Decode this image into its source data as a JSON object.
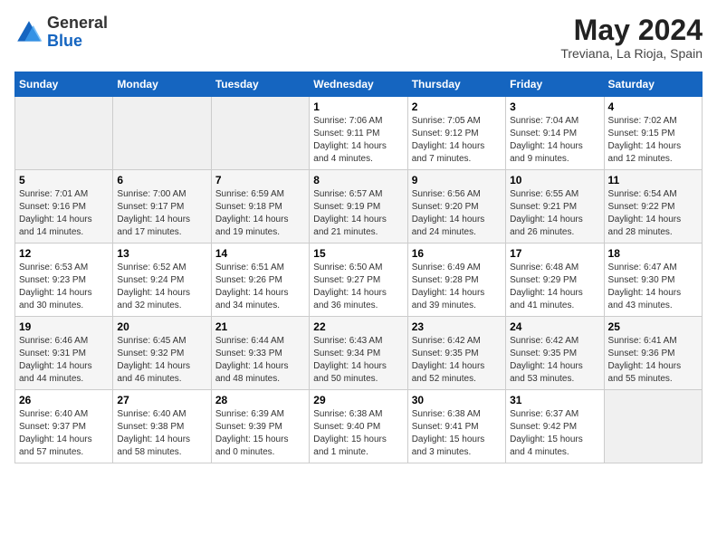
{
  "header": {
    "logo_general": "General",
    "logo_blue": "Blue",
    "month_year": "May 2024",
    "location": "Treviana, La Rioja, Spain"
  },
  "calendar": {
    "weekdays": [
      "Sunday",
      "Monday",
      "Tuesday",
      "Wednesday",
      "Thursday",
      "Friday",
      "Saturday"
    ],
    "weeks": [
      [
        {
          "day": null
        },
        {
          "day": null
        },
        {
          "day": null
        },
        {
          "day": "1",
          "sunrise": "Sunrise: 7:06 AM",
          "sunset": "Sunset: 9:11 PM",
          "daylight": "Daylight: 14 hours and 4 minutes."
        },
        {
          "day": "2",
          "sunrise": "Sunrise: 7:05 AM",
          "sunset": "Sunset: 9:12 PM",
          "daylight": "Daylight: 14 hours and 7 minutes."
        },
        {
          "day": "3",
          "sunrise": "Sunrise: 7:04 AM",
          "sunset": "Sunset: 9:14 PM",
          "daylight": "Daylight: 14 hours and 9 minutes."
        },
        {
          "day": "4",
          "sunrise": "Sunrise: 7:02 AM",
          "sunset": "Sunset: 9:15 PM",
          "daylight": "Daylight: 14 hours and 12 minutes."
        }
      ],
      [
        {
          "day": "5",
          "sunrise": "Sunrise: 7:01 AM",
          "sunset": "Sunset: 9:16 PM",
          "daylight": "Daylight: 14 hours and 14 minutes."
        },
        {
          "day": "6",
          "sunrise": "Sunrise: 7:00 AM",
          "sunset": "Sunset: 9:17 PM",
          "daylight": "Daylight: 14 hours and 17 minutes."
        },
        {
          "day": "7",
          "sunrise": "Sunrise: 6:59 AM",
          "sunset": "Sunset: 9:18 PM",
          "daylight": "Daylight: 14 hours and 19 minutes."
        },
        {
          "day": "8",
          "sunrise": "Sunrise: 6:57 AM",
          "sunset": "Sunset: 9:19 PM",
          "daylight": "Daylight: 14 hours and 21 minutes."
        },
        {
          "day": "9",
          "sunrise": "Sunrise: 6:56 AM",
          "sunset": "Sunset: 9:20 PM",
          "daylight": "Daylight: 14 hours and 24 minutes."
        },
        {
          "day": "10",
          "sunrise": "Sunrise: 6:55 AM",
          "sunset": "Sunset: 9:21 PM",
          "daylight": "Daylight: 14 hours and 26 minutes."
        },
        {
          "day": "11",
          "sunrise": "Sunrise: 6:54 AM",
          "sunset": "Sunset: 9:22 PM",
          "daylight": "Daylight: 14 hours and 28 minutes."
        }
      ],
      [
        {
          "day": "12",
          "sunrise": "Sunrise: 6:53 AM",
          "sunset": "Sunset: 9:23 PM",
          "daylight": "Daylight: 14 hours and 30 minutes."
        },
        {
          "day": "13",
          "sunrise": "Sunrise: 6:52 AM",
          "sunset": "Sunset: 9:24 PM",
          "daylight": "Daylight: 14 hours and 32 minutes."
        },
        {
          "day": "14",
          "sunrise": "Sunrise: 6:51 AM",
          "sunset": "Sunset: 9:26 PM",
          "daylight": "Daylight: 14 hours and 34 minutes."
        },
        {
          "day": "15",
          "sunrise": "Sunrise: 6:50 AM",
          "sunset": "Sunset: 9:27 PM",
          "daylight": "Daylight: 14 hours and 36 minutes."
        },
        {
          "day": "16",
          "sunrise": "Sunrise: 6:49 AM",
          "sunset": "Sunset: 9:28 PM",
          "daylight": "Daylight: 14 hours and 39 minutes."
        },
        {
          "day": "17",
          "sunrise": "Sunrise: 6:48 AM",
          "sunset": "Sunset: 9:29 PM",
          "daylight": "Daylight: 14 hours and 41 minutes."
        },
        {
          "day": "18",
          "sunrise": "Sunrise: 6:47 AM",
          "sunset": "Sunset: 9:30 PM",
          "daylight": "Daylight: 14 hours and 43 minutes."
        }
      ],
      [
        {
          "day": "19",
          "sunrise": "Sunrise: 6:46 AM",
          "sunset": "Sunset: 9:31 PM",
          "daylight": "Daylight: 14 hours and 44 minutes."
        },
        {
          "day": "20",
          "sunrise": "Sunrise: 6:45 AM",
          "sunset": "Sunset: 9:32 PM",
          "daylight": "Daylight: 14 hours and 46 minutes."
        },
        {
          "day": "21",
          "sunrise": "Sunrise: 6:44 AM",
          "sunset": "Sunset: 9:33 PM",
          "daylight": "Daylight: 14 hours and 48 minutes."
        },
        {
          "day": "22",
          "sunrise": "Sunrise: 6:43 AM",
          "sunset": "Sunset: 9:34 PM",
          "daylight": "Daylight: 14 hours and 50 minutes."
        },
        {
          "day": "23",
          "sunrise": "Sunrise: 6:42 AM",
          "sunset": "Sunset: 9:35 PM",
          "daylight": "Daylight: 14 hours and 52 minutes."
        },
        {
          "day": "24",
          "sunrise": "Sunrise: 6:42 AM",
          "sunset": "Sunset: 9:35 PM",
          "daylight": "Daylight: 14 hours and 53 minutes."
        },
        {
          "day": "25",
          "sunrise": "Sunrise: 6:41 AM",
          "sunset": "Sunset: 9:36 PM",
          "daylight": "Daylight: 14 hours and 55 minutes."
        }
      ],
      [
        {
          "day": "26",
          "sunrise": "Sunrise: 6:40 AM",
          "sunset": "Sunset: 9:37 PM",
          "daylight": "Daylight: 14 hours and 57 minutes."
        },
        {
          "day": "27",
          "sunrise": "Sunrise: 6:40 AM",
          "sunset": "Sunset: 9:38 PM",
          "daylight": "Daylight: 14 hours and 58 minutes."
        },
        {
          "day": "28",
          "sunrise": "Sunrise: 6:39 AM",
          "sunset": "Sunset: 9:39 PM",
          "daylight": "Daylight: 15 hours and 0 minutes."
        },
        {
          "day": "29",
          "sunrise": "Sunrise: 6:38 AM",
          "sunset": "Sunset: 9:40 PM",
          "daylight": "Daylight: 15 hours and 1 minute."
        },
        {
          "day": "30",
          "sunrise": "Sunrise: 6:38 AM",
          "sunset": "Sunset: 9:41 PM",
          "daylight": "Daylight: 15 hours and 3 minutes."
        },
        {
          "day": "31",
          "sunrise": "Sunrise: 6:37 AM",
          "sunset": "Sunset: 9:42 PM",
          "daylight": "Daylight: 15 hours and 4 minutes."
        },
        {
          "day": null
        }
      ]
    ]
  }
}
